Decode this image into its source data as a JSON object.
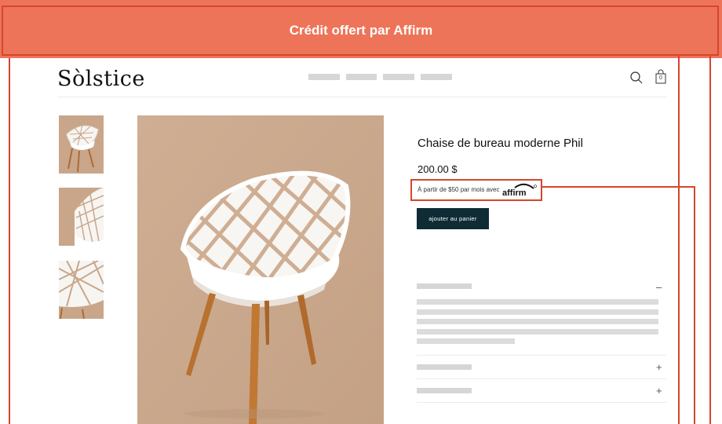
{
  "banner": {
    "title": "Crédit offert par Affirm"
  },
  "store": {
    "logo": "Sòlstice",
    "nav_items": [
      "",
      "",
      "",
      ""
    ],
    "cart_count": "0"
  },
  "product": {
    "title": "Chaise de bureau moderne Phil",
    "price": "200.00 $",
    "financing_text": "À partir de $50 par mois avec",
    "financing_brand": "affirm",
    "add_to_cart_label": "ajouter au panier"
  },
  "accordion": [
    {
      "toggle": "–"
    },
    {
      "toggle": "+"
    },
    {
      "toggle": "+"
    }
  ],
  "colors": {
    "banner": "#ee7459",
    "highlight": "#d5462d",
    "button": "#0f2c35",
    "image_bg": "#c9a88d"
  },
  "icons": [
    "search-icon",
    "shopping-bag-icon"
  ]
}
